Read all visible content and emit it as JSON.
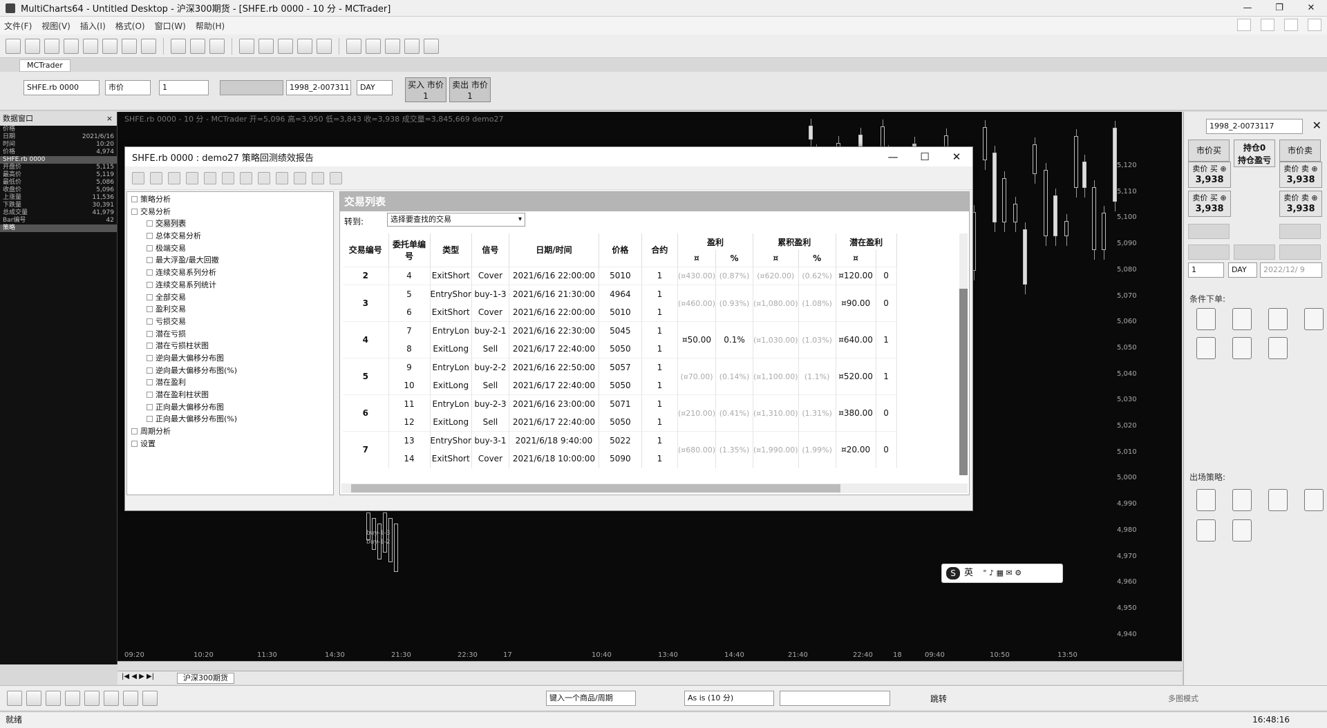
{
  "window": {
    "title": "MultiCharts64 - Untitled Desktop - 沪深300期货 - [SHFE.rb 0000 - 10 分 - MCTrader]",
    "controls": [
      "—",
      "❐",
      "✕"
    ]
  },
  "menu": {
    "items": [
      "文件(F)",
      "视图(V)",
      "插入(I)",
      "格式(O)",
      "窗口(W)",
      "帮助(H)"
    ]
  },
  "trader": {
    "tab": "MCTrader",
    "symbol": "SHFE.rb 0000",
    "order_type": "市价",
    "qty": "1",
    "account": "1998_2-007311",
    "tif": "DAY",
    "buy_label": "买入 市价",
    "buy_qty": "1",
    "sell_label": "卖出 市价",
    "sell_qty": "1"
  },
  "data_window": {
    "title": "数据窗口",
    "rows": [
      {
        "k": "价格",
        "v": "",
        "hl": false
      },
      {
        "k": "日期",
        "v": "2021/6/16",
        "hl": false
      },
      {
        "k": "时间",
        "v": "10:20",
        "hl": false
      },
      {
        "k": "价格",
        "v": "4,974",
        "hl": false
      },
      {
        "k": "SHFE.rb 0000",
        "v": "",
        "hl": true
      },
      {
        "k": "开盘价",
        "v": "5,115",
        "hl": false
      },
      {
        "k": "最高价",
        "v": "5,119",
        "hl": false
      },
      {
        "k": "最低价",
        "v": "5,086",
        "hl": false
      },
      {
        "k": "收盘价",
        "v": "5,096",
        "hl": false
      },
      {
        "k": "上涨量",
        "v": "11,536",
        "hl": false
      },
      {
        "k": "下跌量",
        "v": "30,391",
        "hl": false
      },
      {
        "k": "总成交量",
        "v": "41,979",
        "hl": false
      },
      {
        "k": "Bar编号",
        "v": "42",
        "hl": false
      },
      {
        "k": "策略",
        "v": "",
        "hl": true
      }
    ]
  },
  "chart": {
    "info": "SHFE.rb 0000 - 10 分 - MCTrader  开=5,096  高=3,950  低=3,843  收=3,938  成交量=3,845,669  demo27",
    "price_labels": [
      "5,120",
      "5,110",
      "5,100",
      "5,090",
      "5,080",
      "5,070",
      "5,060",
      "5,050",
      "5,040",
      "5,030",
      "5,020",
      "5,010",
      "5,000",
      "4,990",
      "4,980",
      "4,970",
      "4,960",
      "4,950",
      "4,940"
    ],
    "time_labels": [
      "09:20",
      "10:20",
      "11:30",
      "14:30",
      "21:30",
      "22:30",
      "17",
      "10:40",
      "13:40",
      "14:40",
      "21:40",
      "22:40",
      "18",
      "09:40",
      "10:50",
      "13:50"
    ],
    "sheet_tab": "沪深300期货",
    "annotations": [
      "buy-1-3",
      "buy-1-2"
    ]
  },
  "dialog": {
    "title": "SHFE.rb 0000 : demo27 策略回测绩效报告",
    "tree": [
      {
        "label": "策略分析",
        "level": 0
      },
      {
        "label": "交易分析",
        "level": 0
      },
      {
        "label": "交易列表",
        "level": 1
      },
      {
        "label": "总体交易分析",
        "level": 1
      },
      {
        "label": "极端交易",
        "level": 1
      },
      {
        "label": "最大浮盈/最大回撤",
        "level": 1
      },
      {
        "label": "连续交易系列分析",
        "level": 1
      },
      {
        "label": "连续交易系列统计",
        "level": 1
      },
      {
        "label": "全部交易",
        "level": 1
      },
      {
        "label": "盈利交易",
        "level": 1
      },
      {
        "label": "亏损交易",
        "level": 1
      },
      {
        "label": "潜在亏损",
        "level": 1
      },
      {
        "label": "潜在亏损柱状图",
        "level": 1
      },
      {
        "label": "逆向最大偏移分布图",
        "level": 1
      },
      {
        "label": "逆向最大偏移分布图(%)",
        "level": 1
      },
      {
        "label": "潜在盈利",
        "level": 1
      },
      {
        "label": "潜在盈利柱状图",
        "level": 1
      },
      {
        "label": "正向最大偏移分布图",
        "level": 1
      },
      {
        "label": "正向最大偏移分布图(%)",
        "level": 1
      },
      {
        "label": "周期分析",
        "level": 0
      },
      {
        "label": "设置",
        "level": 0
      }
    ],
    "content_title": "交易列表",
    "goto_label": "转到:",
    "goto_value": "选择要查找的交易",
    "headers": {
      "trade_no": "交易编号",
      "order_no": "委托单编号",
      "type": "类型",
      "signal": "信号",
      "datetime": "日期/时间",
      "price": "价格",
      "contracts": "合约",
      "profit": "盈利",
      "cum_profit": "累积盈利",
      "potential": "潜在盈利",
      "cur": "¤",
      "pct": "%"
    },
    "trades": [
      {
        "no": "2",
        "rows": [
          {
            "order": "4",
            "type": "ExitShort",
            "signal": "Cover",
            "dt": "2021/6/16 22:00:00",
            "price": "5010",
            "qty": "1"
          }
        ],
        "profit": "(¤430.00)",
        "profit_pct": "(0.87%)",
        "cum": "(¤620.00)",
        "cum_pct": "(0.62%)",
        "pot": "¤120.00",
        "pot2": "0"
      },
      {
        "no": "3",
        "rows": [
          {
            "order": "5",
            "type": "EntryShor",
            "signal": "buy-1-3",
            "dt": "2021/6/16 21:30:00",
            "price": "4964",
            "qty": "1"
          },
          {
            "order": "6",
            "type": "ExitShort",
            "signal": "Cover",
            "dt": "2021/6/16 22:00:00",
            "price": "5010",
            "qty": "1"
          }
        ],
        "profit": "(¤460.00)",
        "profit_pct": "(0.93%)",
        "cum": "(¤1,080.00)",
        "cum_pct": "(1.08%)",
        "pot": "¤90.00",
        "pot2": "0"
      },
      {
        "no": "4",
        "rows": [
          {
            "order": "7",
            "type": "EntryLon",
            "signal": "buy-2-1",
            "dt": "2021/6/16 22:30:00",
            "price": "5045",
            "qty": "1"
          },
          {
            "order": "8",
            "type": "ExitLong",
            "signal": "Sell",
            "dt": "2021/6/17 22:40:00",
            "price": "5050",
            "qty": "1"
          }
        ],
        "profit": "¤50.00",
        "profit_pct": "0.1%",
        "cum": "(¤1,030.00)",
        "cum_pct": "(1.03%)",
        "pot": "¤640.00",
        "pot2": "1"
      },
      {
        "no": "5",
        "rows": [
          {
            "order": "9",
            "type": "EntryLon",
            "signal": "buy-2-2",
            "dt": "2021/6/16 22:50:00",
            "price": "5057",
            "qty": "1"
          },
          {
            "order": "10",
            "type": "ExitLong",
            "signal": "Sell",
            "dt": "2021/6/17 22:40:00",
            "price": "5050",
            "qty": "1"
          }
        ],
        "profit": "(¤70.00)",
        "profit_pct": "(0.14%)",
        "cum": "(¤1,100.00)",
        "cum_pct": "(1.1%)",
        "pot": "¤520.00",
        "pot2": "1"
      },
      {
        "no": "6",
        "rows": [
          {
            "order": "11",
            "type": "EntryLon",
            "signal": "buy-2-3",
            "dt": "2021/6/16 23:00:00",
            "price": "5071",
            "qty": "1"
          },
          {
            "order": "12",
            "type": "ExitLong",
            "signal": "Sell",
            "dt": "2021/6/17 22:40:00",
            "price": "5050",
            "qty": "1"
          }
        ],
        "profit": "(¤210.00)",
        "profit_pct": "(0.41%)",
        "cum": "(¤1,310.00)",
        "cum_pct": "(1.31%)",
        "pot": "¤380.00",
        "pot2": "0"
      },
      {
        "no": "7",
        "rows": [
          {
            "order": "13",
            "type": "EntryShor",
            "signal": "buy-3-1",
            "dt": "2021/6/18 9:40:00",
            "price": "5022",
            "qty": "1"
          },
          {
            "order": "14",
            "type": "ExitShort",
            "signal": "Cover",
            "dt": "2021/6/18 10:00:00",
            "price": "5090",
            "qty": "1"
          }
        ],
        "profit": "(¤680.00)",
        "profit_pct": "(1.35%)",
        "cum": "(¤1,990.00)",
        "cum_pct": "(1.99%)",
        "pot": "¤20.00",
        "pot2": "0"
      }
    ]
  },
  "order_panel": {
    "account": "1998_2-0073117",
    "btn_market_buy": "市价买",
    "btn_position": "持仓0",
    "btn_position2": "持仓盈亏",
    "btn_market_sell": "市价卖",
    "bid_label": "卖价 买 ⊕",
    "bid_value": "3,938",
    "ask_label": "卖价 卖 ⊕",
    "ask_value": "3,938",
    "bid2_label": "卖价 买 ⊕",
    "bid2_value": "3,938",
    "ask2_label": "卖价 卖 ⊕",
    "ask2_value": "3,938",
    "qty": "1",
    "tif": "DAY",
    "date": "2022/12/ 9",
    "cond_label": "条件下单:",
    "exit_label": "出场策略:"
  },
  "drawing": {
    "symbol_input": "键入一个商品/周期",
    "resolution": "As is (10 分)",
    "jump_label": "跳转",
    "multi_label": "多图模式"
  },
  "ime": {
    "label": "英"
  },
  "status": {
    "left": "就绪",
    "time": "16:48:16"
  }
}
